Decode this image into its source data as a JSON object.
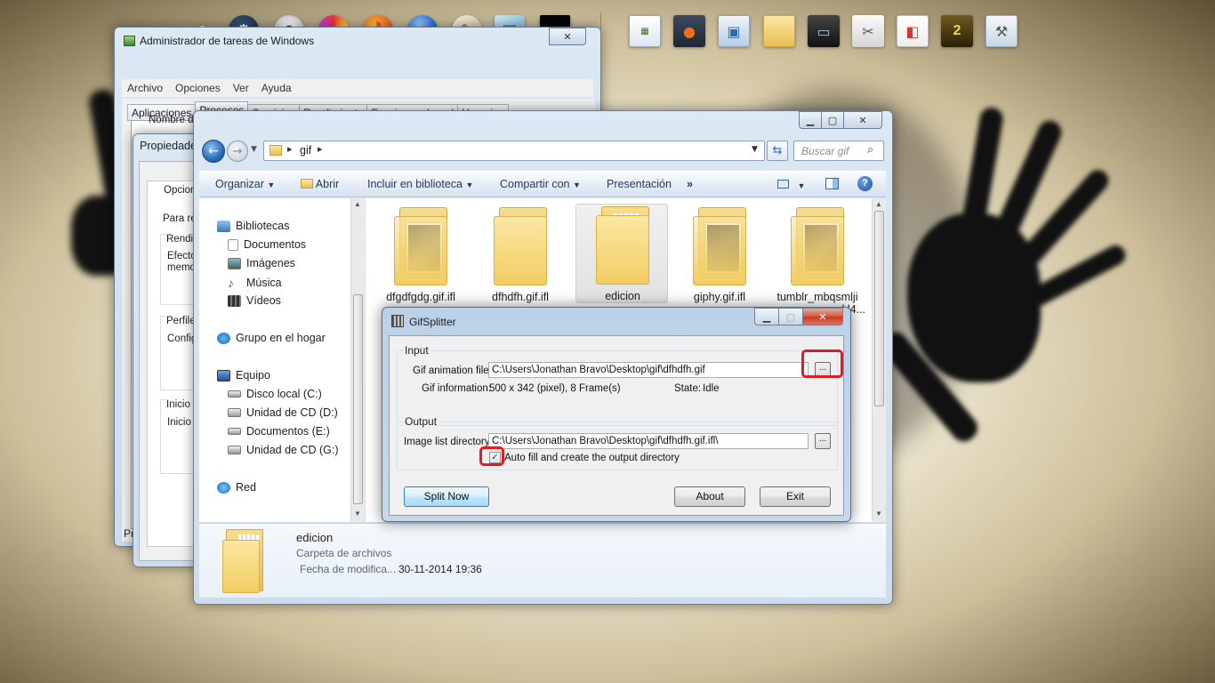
{
  "dock": {
    "app_icons": [
      "steam-icon",
      "eye-icon",
      "paint-palette-icon",
      "firefox-icon",
      "google-earth-icon",
      "brush-icon",
      "notepad-icon",
      "console-icon"
    ],
    "tray_icons": [
      "window-icon",
      "firefox-window-icon",
      "app-window-icon",
      "folder-icon",
      "steam-window-icon",
      "scissors-icon",
      "paint-icon",
      "left4dead2-icon",
      "settings-icon"
    ],
    "tray_badges": {
      "l4d2": "2"
    }
  },
  "task_manager": {
    "title": "Administrador de tareas de Windows",
    "menu": [
      "Archivo",
      "Opciones",
      "Ver",
      "Ayuda"
    ],
    "tabs": [
      "Aplicaciones",
      "Procesos",
      "Servicios",
      "Rendimiento",
      "Funciones de red",
      "Usuarios"
    ],
    "active_tab": "Procesos",
    "column_header": "Nombre de",
    "footer_prefix": "Pr"
  },
  "properties_window": {
    "title": "Propiedade",
    "lines": [
      "Opcion",
      "Para re",
      "Rendi",
      "Efecto",
      "memor",
      "Perfile",
      "Config",
      "Inicio y",
      "Inicio"
    ]
  },
  "explorer": {
    "breadcrumb": [
      "gif"
    ],
    "search_placeholder": "Buscar gif",
    "commands": [
      "Organizar",
      "Abrir",
      "Incluir en biblioteca",
      "Compartir con",
      "Presentación"
    ],
    "more_commands": "»",
    "nav": {
      "libraries": "Bibliotecas",
      "library_items": [
        "Documentos",
        "Imágenes",
        "Música",
        "Vídeos"
      ],
      "homegroup": "Grupo en el hogar",
      "computer": "Equipo",
      "drives": [
        "Disco local (C:)",
        "Unidad de CD (D:)",
        "Documentos (E:)",
        "Unidad de CD (G:)"
      ],
      "network": "Red"
    },
    "files": [
      {
        "name": "dfgdfgdg.gif.ifl",
        "selected": false,
        "preview": true
      },
      {
        "name": "dfhdfh.gif.ifl",
        "selected": false,
        "preview": false
      },
      {
        "name": "edicion",
        "selected": true,
        "preview": false
      },
      {
        "name": "giphy.gif.ifl",
        "selected": false,
        "preview": true
      },
      {
        "name": "tumblr_mbqsmlji",
        "selected": false,
        "preview": true
      }
    ],
    "partial_label": "kl4...",
    "details": {
      "name": "edicion",
      "type": "Carpeta de archivos",
      "modified_label": "Fecha de modifica...",
      "modified_value": "30-11-2014 19:36"
    }
  },
  "gifsplitter": {
    "title": "GifSplitter",
    "input": {
      "legend": "Input",
      "file_label": "Gif animation file:",
      "file_value": "C:\\Users\\Jonathan Bravo\\Desktop\\gif\\dfhdfh.gif",
      "info_label": "Gif information:",
      "info_value": "500 x 342 (pixel), 8 Frame(s)",
      "state_label": "State:",
      "state_value": "Idle"
    },
    "output": {
      "legend": "Output",
      "dir_label": "Image list directory:",
      "dir_value": "C:\\Users\\Jonathan Bravo\\Desktop\\gif\\dfhdfh.gif.ifl\\",
      "autofill_label": "Auto fill and create the output directory",
      "autofill_checked": true
    },
    "browse_label": "...",
    "buttons": {
      "split": "Split Now",
      "about": "About",
      "exit": "Exit"
    },
    "highlight_color": "#e01b22"
  }
}
